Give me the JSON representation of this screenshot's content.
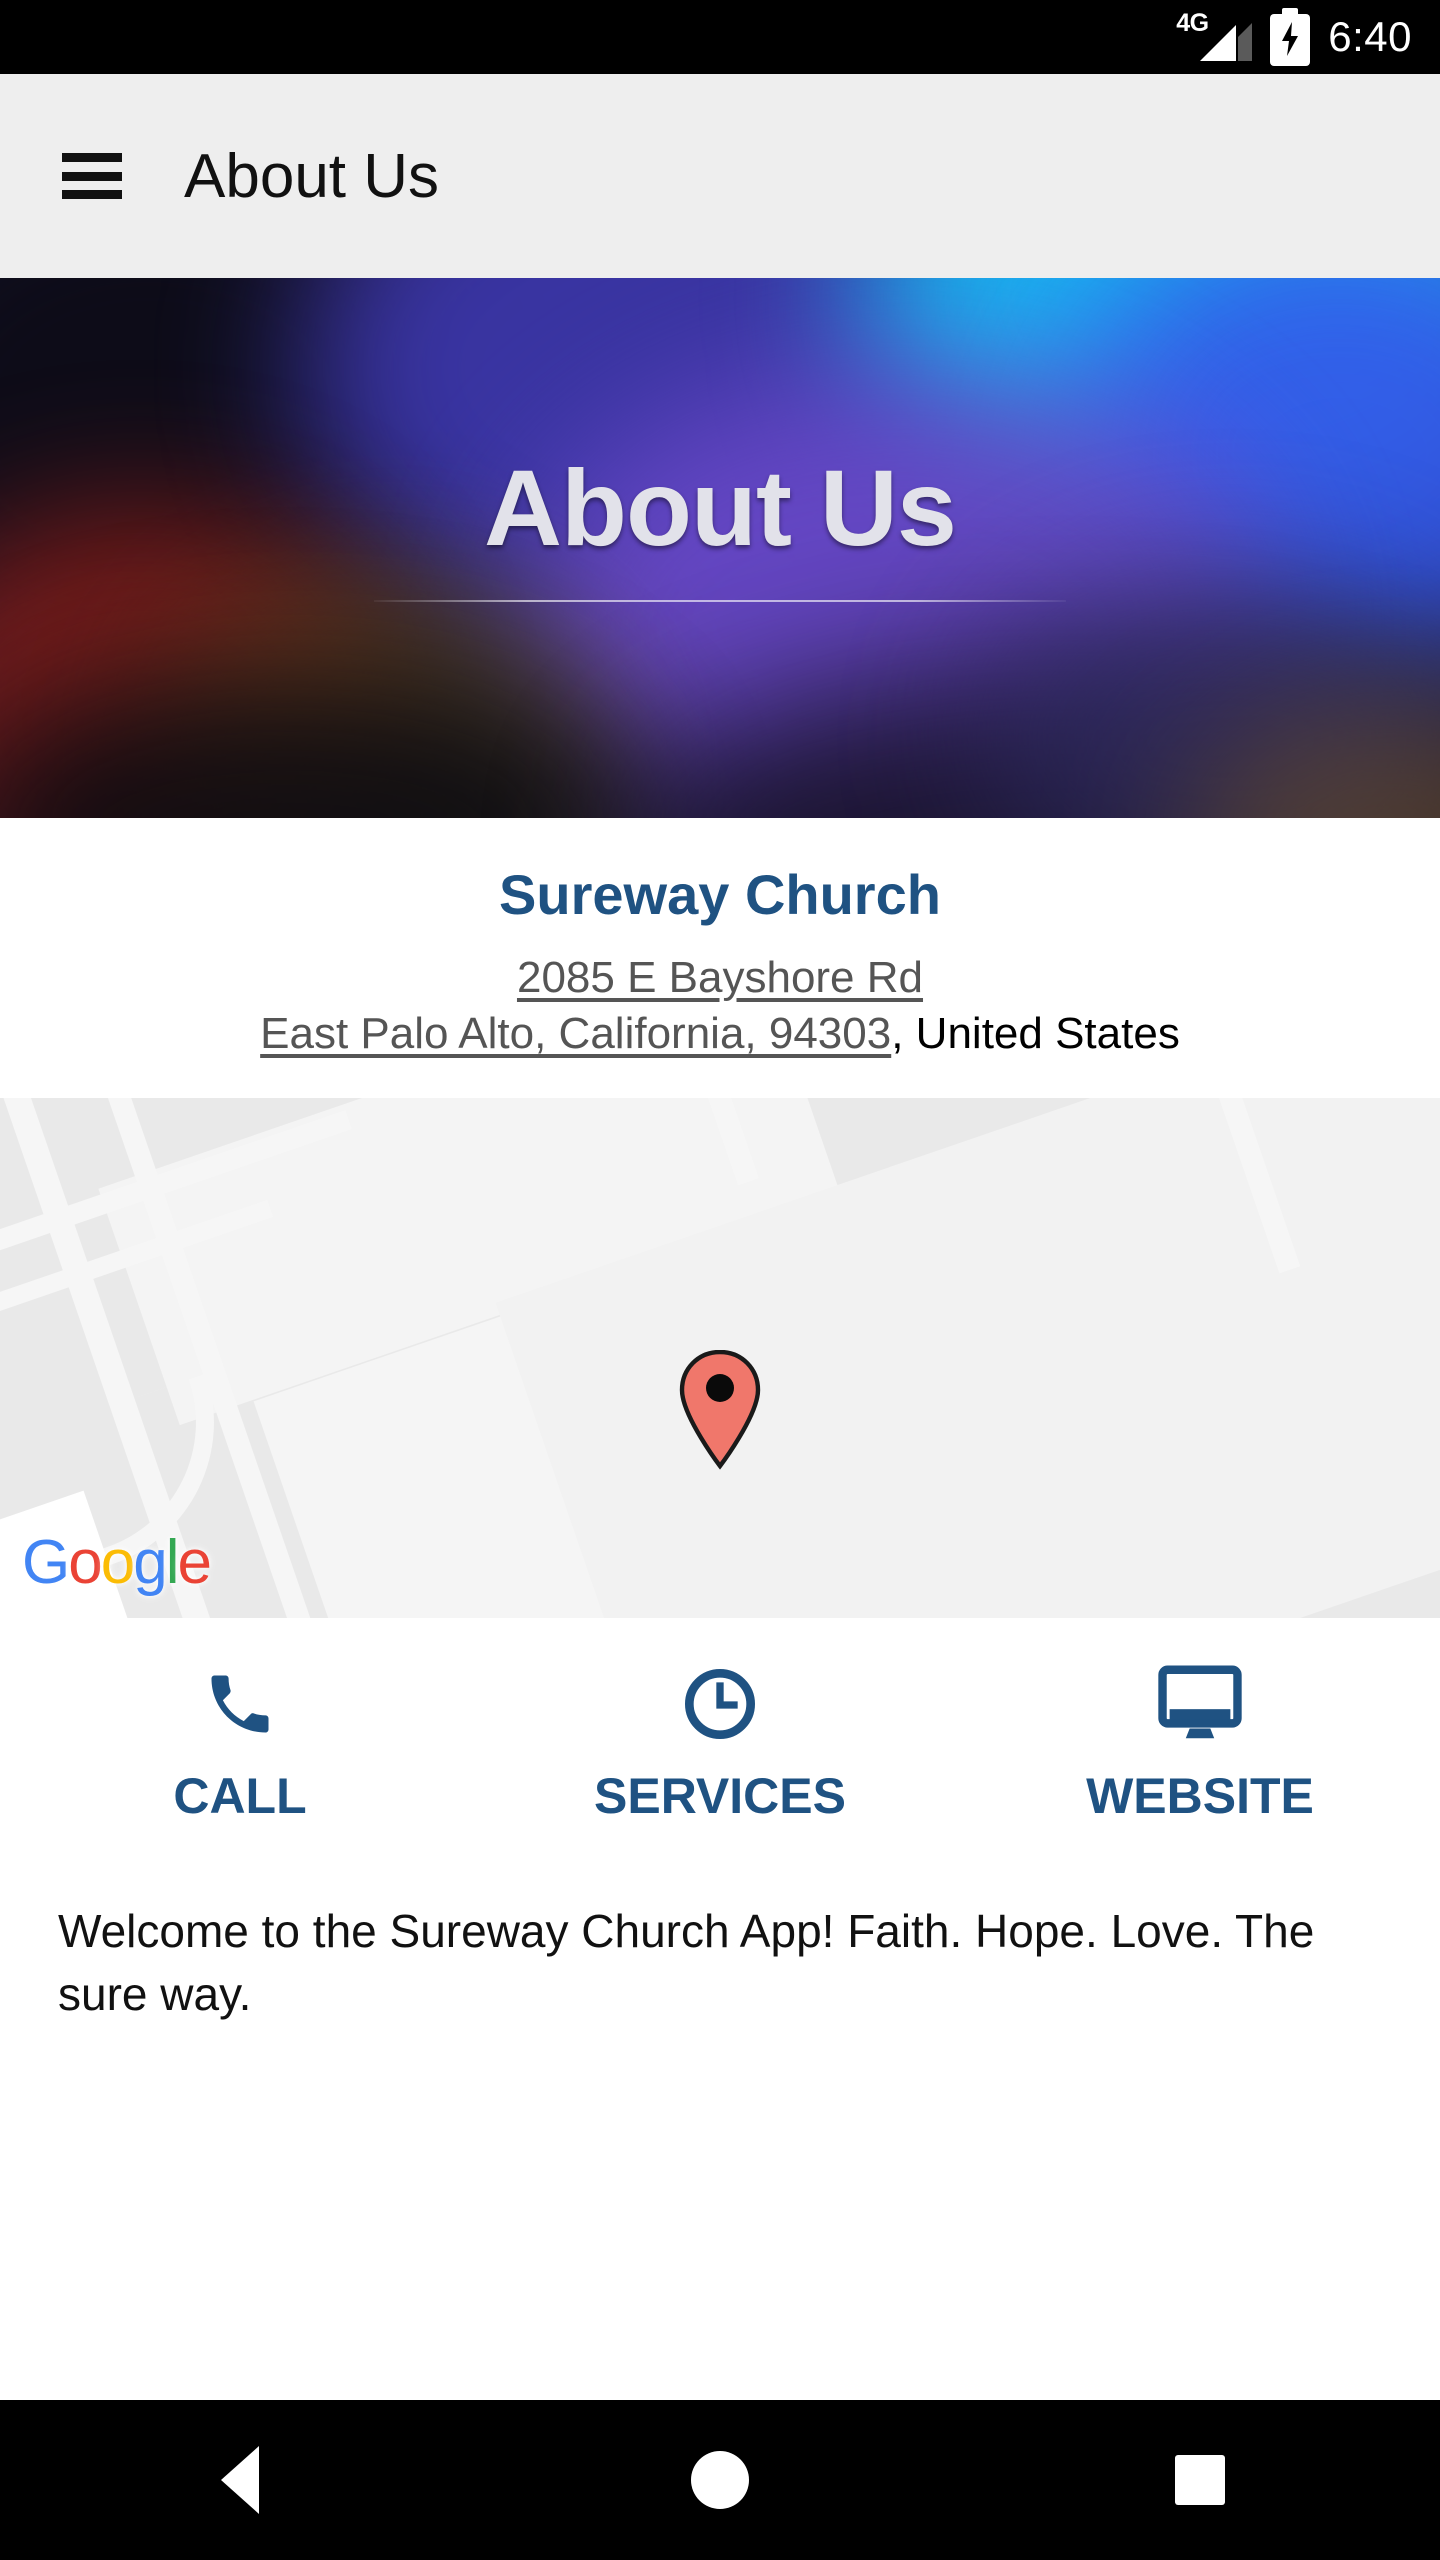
{
  "status_bar": {
    "network_type": "4G",
    "signal_icon": "signal-bars-icon",
    "battery_icon": "battery-charging-icon",
    "time": "6:40"
  },
  "app_bar": {
    "menu_icon": "hamburger-menu-icon",
    "title": "About Us"
  },
  "hero": {
    "title": "About Us"
  },
  "organization": {
    "name": "Sureway Church",
    "address_line1": "2085 E Bayshore Rd",
    "address_line2": "East Palo Alto, California, 94303",
    "country_suffix": ", United States"
  },
  "map": {
    "marker_icon": "map-pin-icon",
    "attribution": "Google",
    "attribution_letters": [
      "G",
      "o",
      "o",
      "g",
      "l",
      "e"
    ],
    "attribution_colors": [
      "#4285F4",
      "#EA4335",
      "#FBBC05",
      "#4285F4",
      "#34A853",
      "#EA4335"
    ]
  },
  "actions": [
    {
      "icon": "phone-icon",
      "label": "CALL"
    },
    {
      "icon": "clock-icon",
      "label": "SERVICES"
    },
    {
      "icon": "monitor-icon",
      "label": "WEBSITE"
    }
  ],
  "description": {
    "text": "Welcome to the Sureway Church App! Faith. Hope. Love. The sure way."
  },
  "nav_bar": {
    "back_icon": "back-triangle-icon",
    "home_icon": "home-circle-icon",
    "recents_icon": "recents-square-icon"
  },
  "colors": {
    "brand_blue": "#1f5282",
    "appbar_bg": "#eeeeee",
    "status_bg": "#000000",
    "map_bg": "#e9e9e9",
    "pin_red": "#f0776b"
  }
}
